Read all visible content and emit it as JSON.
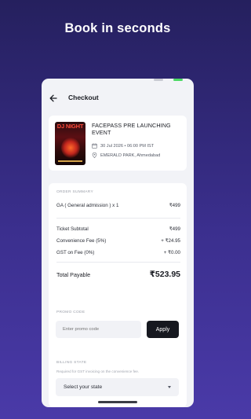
{
  "headline": "Book in seconds",
  "appbar": {
    "title": "Checkout"
  },
  "event": {
    "poster_text": "DJ NIGHT",
    "title": "FACEPASS PRE LAUNCHING EVENT",
    "date": "30 Jul 2026 • 06:00 PM IST",
    "venue": "EMERALD PARK, Ahmedabad"
  },
  "order": {
    "section_label": "ORDER SUMMARY",
    "ticket_line": {
      "label": "GA ( General admission ) x 1",
      "value": "₹499"
    },
    "subtotal": {
      "label": "Ticket Subtotal",
      "value": "₹499"
    },
    "convenience_fee": {
      "label": "Convenience Fee (5%)",
      "value": "+ ₹24.95"
    },
    "gst": {
      "label": "GST on Fee (0%)",
      "value": "+ ₹0.00"
    },
    "total": {
      "label": "Total Payable",
      "value": "₹523.95"
    }
  },
  "promo": {
    "section_label": "PROMO CODE",
    "placeholder": "Enter promo code",
    "apply_label": "Apply"
  },
  "billing": {
    "section_label": "BILLING STATE",
    "help": "Required for GST invoicing on the convenience fee.",
    "select_value": "Select your state"
  },
  "icons": {
    "back": "arrow-left-icon",
    "date": "calendar-icon",
    "venue": "map-pin-icon",
    "caret": "chevron-down-icon"
  },
  "colors": {
    "background_top": "#25205e",
    "background_bottom": "#4a3aa8",
    "apply_button": "#16181f",
    "status_green": "#4cd964"
  }
}
